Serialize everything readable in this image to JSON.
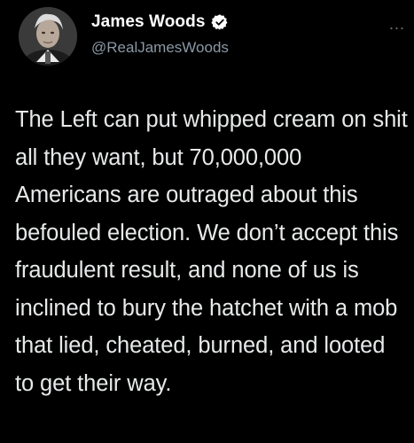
{
  "tweet": {
    "display_name": "James Woods",
    "handle": "@RealJamesWoods",
    "verified": true,
    "more_menu": "...",
    "text": "The Left can put whipped cream on shit all they want, but 70,000,000 Americans are outraged about this befouled election. We don’t accept this fraudulent result, and none of us is inclined to bury the hatchet with a mob that lied, cheated, burned, and looted to get their way."
  },
  "icons": {
    "verified": "verified-badge-icon",
    "more": "more-horizontal-icon",
    "avatar": "profile-avatar"
  },
  "colors": {
    "background": "#000000",
    "text": "#e7e9ea",
    "secondary": "#8b98a5",
    "verified": "#ffffff"
  }
}
